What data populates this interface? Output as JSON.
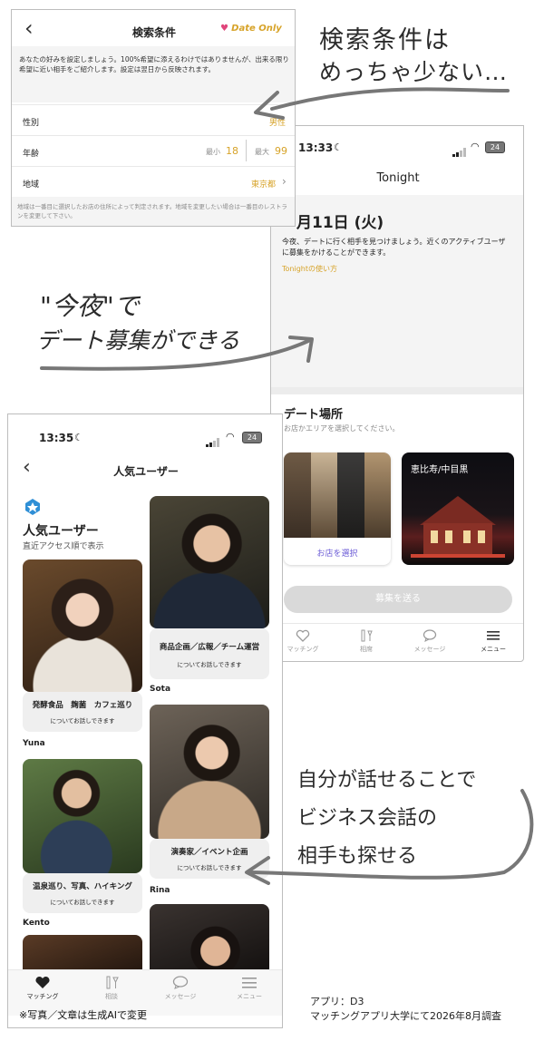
{
  "search_screen": {
    "title": "検索条件",
    "back_glyph": "‹",
    "date_only_label": "Date Only",
    "notice": "あなたの好みを設定しましょう。100%希望に添えるわけではありませんが、出来る限り希望に近い相手をご紹介します。設定は翌日から反映されます。",
    "gender_label": "性別",
    "gender_value": "男性",
    "age_label": "年齢",
    "age_min_label": "最小",
    "age_min_value": "18",
    "age_max_label": "最大",
    "age_max_value": "99",
    "area_label": "地域",
    "area_value": "東京都",
    "footer_note": "地域は一番目に選択したお店の住所によって判定されます。地域を変更したい場合は一番目のレストランを変更して下さい。"
  },
  "tonight_screen": {
    "time": "13:33",
    "battery": "24",
    "title": "Tonight",
    "date_heading": "月11日 (火)",
    "description": "今夜、デートに行く相手を見つけましょう。近くのアクティブユーザに募集をかけることができます。",
    "howto_link": "Tonightの使い方",
    "place_title": "デート場所",
    "place_hint": "お店かエリアを選択してください。",
    "select_shop_label": "お店を選択",
    "area_card_label": "恵比寿/中目黒",
    "submit_button": "募集を送る",
    "tabs": [
      "マッチング",
      "相席",
      "メッセージ",
      "メニュー"
    ]
  },
  "popular_screen": {
    "time": "13:35",
    "battery": "24",
    "nav_title": "人気ユーザー",
    "heading": "人気ユーザー",
    "subheading": "直近アクセス順で表示",
    "users": [
      {
        "name": "Yuna",
        "topic": "発酵食品　麹菌　カフェ巡り",
        "suffix": "についてお話しできます"
      },
      {
        "name": "Sota",
        "topic": "商品企画／広報／チーム運営",
        "suffix": "についてお話しできます"
      },
      {
        "name": "Kento",
        "topic": "温泉巡り、写真、ハイキング",
        "suffix": "についてお話しできます"
      },
      {
        "name": "Rina",
        "topic": "演奏家／イベント企画",
        "suffix": "についてお話しできます"
      }
    ],
    "tabs": [
      "マッチング",
      "相談",
      "メッセージ",
      "メニュー"
    ]
  },
  "annotations": {
    "top_line1": "検索条件は",
    "top_line2": "めっちゃ少ない…",
    "mid_line1": "\"今夜\"で",
    "mid_line2": "デート募集ができる",
    "bottom_line1": "自分が話せることで",
    "bottom_line2": "ビジネス会話の",
    "bottom_line3": "相手も探せる"
  },
  "footer": {
    "disclaimer": "※写真／文章は生成AIで変更",
    "app_label": "アプリ：D3",
    "survey_label": "マッチングアプリ大学にて2026年8月調査"
  },
  "colors": {
    "gold": "#d7a329",
    "pink": "#e0457b",
    "purple": "#6b5bd6"
  }
}
